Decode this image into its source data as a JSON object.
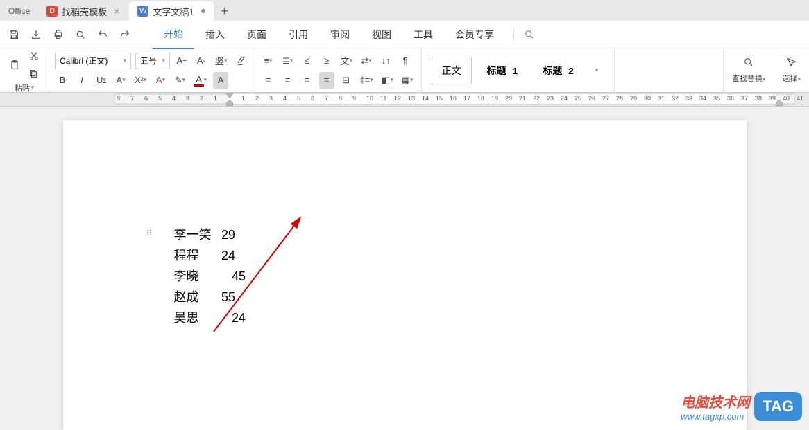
{
  "app_label": "Office",
  "tabs": [
    {
      "icon": "D",
      "label": "找稻壳模板",
      "active": false,
      "closable": true
    },
    {
      "icon": "W",
      "label": "文字文稿1",
      "active": true,
      "closable": false
    }
  ],
  "menu": {
    "items": [
      "开始",
      "插入",
      "页面",
      "引用",
      "审阅",
      "视图",
      "工具",
      "会员专享"
    ],
    "active_index": 0
  },
  "ribbon": {
    "paste_label": "粘贴",
    "font_name": "Calibri (正文)",
    "font_size": "五号",
    "styles": {
      "body": "正文",
      "h1": "标题 1",
      "h2": "标题 2"
    },
    "find_replace": "查找替换",
    "select": "选择"
  },
  "ruler": {
    "left_numbers": [
      "8",
      "7",
      "6",
      "5",
      "4",
      "3",
      "2",
      "1"
    ],
    "right_numbers": [
      "1",
      "2",
      "3",
      "4",
      "5",
      "6",
      "7",
      "8",
      "9",
      "10",
      "11",
      "12",
      "13",
      "14",
      "15",
      "16",
      "17",
      "18",
      "19",
      "20",
      "21",
      "22",
      "23",
      "24",
      "25",
      "26",
      "27",
      "28",
      "29",
      "30",
      "31",
      "32",
      "33",
      "34",
      "35",
      "36",
      "37",
      "38",
      "39",
      "40",
      "41"
    ]
  },
  "document": {
    "lines": [
      {
        "name": "李一笑",
        "value": "29",
        "spacer": ""
      },
      {
        "name": "程程",
        "value": "24",
        "spacer": ""
      },
      {
        "name": "李晓",
        "value": "45",
        "spacer": "   "
      },
      {
        "name": "赵成",
        "value": "55",
        "spacer": ""
      },
      {
        "name": "吴思",
        "value": "24",
        "spacer": "   "
      }
    ]
  },
  "watermark": {
    "text": "电脑技术网",
    "url": "www.tagxp.com",
    "tag": "TAG"
  }
}
